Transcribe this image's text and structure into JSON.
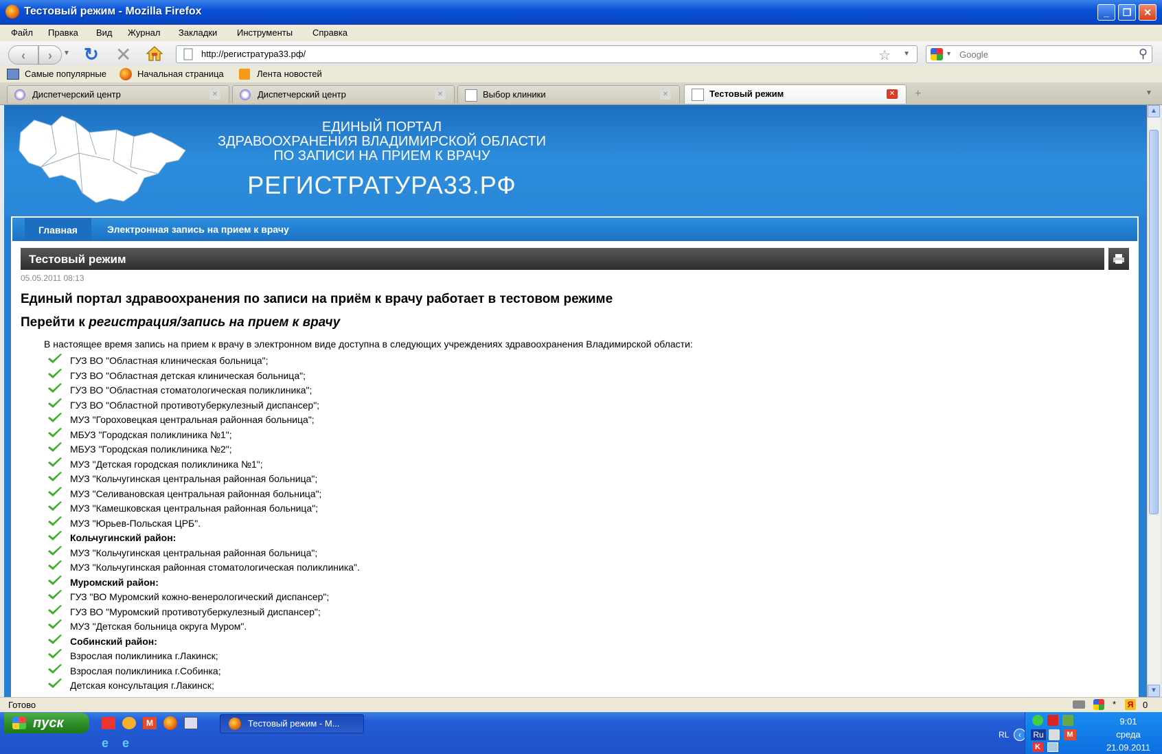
{
  "window": {
    "title": "Тестовый режим - Mozilla Firefox",
    "min_label": "_",
    "max_label": "❐",
    "close_label": "✕"
  },
  "menu": [
    "Файл",
    "Правка",
    "Вид",
    "Журнал",
    "Закладки",
    "Инструменты",
    "Справка"
  ],
  "toolbar": {
    "url": "http://регистратура33.рф/",
    "search_placeholder": "Google"
  },
  "bookmarks": [
    "Самые популярные",
    "Начальная страница",
    "Лента новостей"
  ],
  "tabs": [
    {
      "label": "Диспетчерский центр",
      "active": false
    },
    {
      "label": "Диспетчерский центр",
      "active": false
    },
    {
      "label": "Выбор клиники",
      "active": false
    },
    {
      "label": "Тестовый режим",
      "active": true
    }
  ],
  "site": {
    "header_line1": "ЕДИНЫЙ ПОРТАЛ",
    "header_line2": "ЗДРАВООХРАНЕНИЯ ВЛАДИМИРСКОЙ ОБЛАСТИ",
    "header_line3": "ПО ЗАПИСИ НА ПРИЕМ К ВРАЧУ",
    "header_big": "РЕГИСТРАТУРА33.РФ",
    "nav": [
      "Главная",
      "Электронная запись на прием к врачу"
    ]
  },
  "article": {
    "title": "Тестовый режим",
    "date": "05.05.2011 08:13",
    "heading": "Единый портал здравоохранения по записи на приём к врачу работает в тестовом режиме",
    "goto_prefix": "Перейти к",
    "goto_link": "регистрация/запись на прием к врачу",
    "intro": "В настоящее время запись на прием к врачу в электронном виде доступна в следующих учреждениях здравоохранения Владимирской области:",
    "items": [
      {
        "text": "ГУЗ ВО \"Областная клиническая больница\";",
        "bold": false
      },
      {
        "text": "ГУЗ ВО \"Областная детская клиническая больница\";",
        "bold": false
      },
      {
        "text": "ГУЗ ВО \"Областная стоматологическая поликлиника\";",
        "bold": false
      },
      {
        "text": "ГУЗ ВО \"Областной противотуберкулезный диспансер\";",
        "bold": false
      },
      {
        "text": "МУЗ \"Гороховецкая центральная районная больница\";",
        "bold": false
      },
      {
        "text": "МБУЗ \"Городская поликлиника №1\";",
        "bold": false
      },
      {
        "text": "МБУЗ \"Городская поликлиника №2\";",
        "bold": false
      },
      {
        "text": "МУЗ \"Детская городская поликлиника №1\";",
        "bold": false
      },
      {
        "text": "МУЗ \"Кольчугинская центральная районная больница\";",
        "bold": false
      },
      {
        "text": " МУЗ \"Селивановская центральная районная больница\";",
        "bold": false
      },
      {
        "text": "МУЗ \"Камешковская центральная районная больница\";",
        "bold": false
      },
      {
        "text": "МУЗ \"Юрьев-Польская ЦРБ\".",
        "bold": false
      },
      {
        "text": "Кольчугинский район:",
        "bold": true
      },
      {
        "text": "МУЗ \"Кольчугинская центральная районная больница\";",
        "bold": false
      },
      {
        "text": "МУЗ \"Кольчугинская районная стоматологическая поликлиника\".",
        "bold": false
      },
      {
        "text": "Муромский район:",
        "bold": true
      },
      {
        "text": "ГУЗ \"ВО Муромский кожно-венерологический диспансер\";",
        "bold": false
      },
      {
        "text": "ГУЗ ВО \"Муромский противотуберкулезный диспансер\";",
        "bold": false
      },
      {
        "text": "МУЗ \"Детская больница округа Муром\".",
        "bold": false
      },
      {
        "text": "Собинский район:",
        "bold": true
      },
      {
        "text": "Взрослая поликлиника г.Лакинск;",
        "bold": false
      },
      {
        "text": "Взрослая поликлиника г.Собинка;",
        "bold": false
      },
      {
        "text": "Детская консультация г.Лакинск;",
        "bold": false
      }
    ]
  },
  "status": {
    "text": "Готово",
    "right_count": "0"
  },
  "taskbar": {
    "start_label": "пуск",
    "task_label": "Тестовый режим - M...",
    "lang": "RL",
    "lang2": "Ru",
    "time": "9:01",
    "weekday": "среда",
    "date": "21.09.2011"
  },
  "colors": {
    "site_blue": "#2a86d6",
    "check_green": "#3cae2a",
    "article_bar": "#3a3a3a"
  }
}
